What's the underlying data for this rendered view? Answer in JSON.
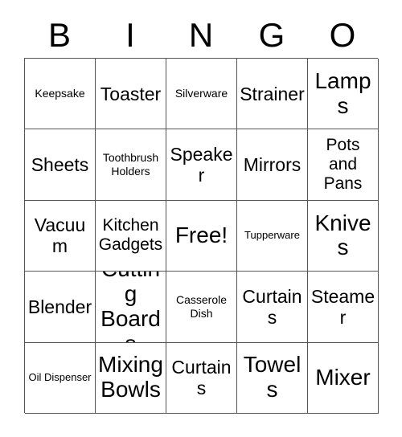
{
  "card": {
    "title_letters": [
      "B",
      "I",
      "N",
      "G",
      "O"
    ],
    "border_color": "#555555",
    "background_color": "#ffffff",
    "text_color": "#000000",
    "rows": [
      [
        {
          "label": "Keepsake",
          "size": "sm"
        },
        {
          "label": "Toaster",
          "size": "lg"
        },
        {
          "label": "Silverware",
          "size": "sm"
        },
        {
          "label": "Strainer",
          "size": "lg"
        },
        {
          "label": "Lamps",
          "size": "xl"
        }
      ],
      [
        {
          "label": "Sheets",
          "size": "lg"
        },
        {
          "label": "Toothbrush Holders",
          "size": "sm"
        },
        {
          "label": "Speaker",
          "size": "lg"
        },
        {
          "label": "Mirrors",
          "size": "lg"
        },
        {
          "label": "Pots and Pans",
          "size": "md"
        }
      ],
      [
        {
          "label": "Vacuum",
          "size": "lg"
        },
        {
          "label": "Kitchen Gadgets",
          "size": "md"
        },
        {
          "label": "Free!",
          "size": "xl"
        },
        {
          "label": "Tupperware",
          "size": "xs"
        },
        {
          "label": "Knives",
          "size": "xl"
        }
      ],
      [
        {
          "label": "Blender",
          "size": "lg"
        },
        {
          "label": "Cutting Boards",
          "size": "xl"
        },
        {
          "label": "Casserole Dish",
          "size": "sm"
        },
        {
          "label": "Curtains",
          "size": "lg"
        },
        {
          "label": "Steamer",
          "size": "lg"
        }
      ],
      [
        {
          "label": "Oil Dispenser",
          "size": "xs"
        },
        {
          "label": "Mixing Bowls",
          "size": "xl"
        },
        {
          "label": "Curtains",
          "size": "lg"
        },
        {
          "label": "Towels",
          "size": "xl"
        },
        {
          "label": "Mixer",
          "size": "xl"
        }
      ]
    ]
  }
}
